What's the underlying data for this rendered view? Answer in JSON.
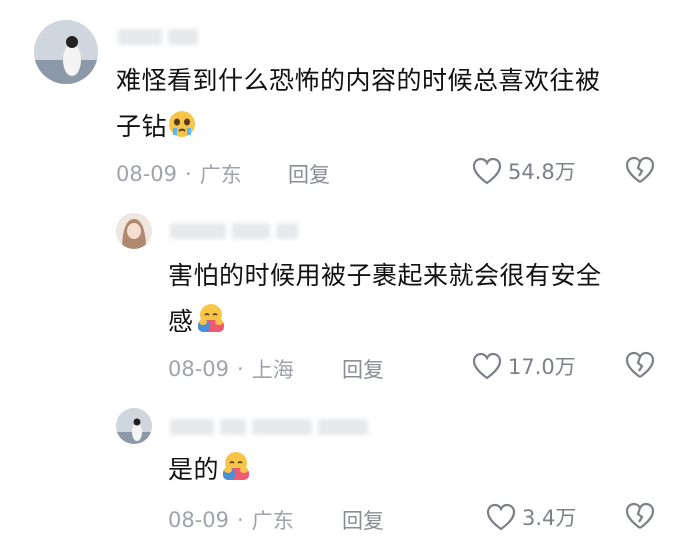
{
  "comments": [
    {
      "text_line1": "难怪看到什么恐怖的内容的时候总喜欢往被",
      "text_line2": "子钻",
      "emoji": "crying-face",
      "date": "08-09",
      "location": "广东",
      "reply": "回复",
      "likes": "54.8万"
    },
    {
      "text_line1": "害怕的时候用被子裹起来就会很有安全",
      "text_line2": "感",
      "emoji": "hugging-face",
      "date": "08-09",
      "location": "上海",
      "reply": "回复",
      "likes": "17.0万"
    },
    {
      "text_line1": "是的",
      "emoji": "hugging-face",
      "date": "08-09",
      "location": "广东",
      "reply": "回复",
      "likes": "3.4万"
    }
  ],
  "meta_separator": "·",
  "colors": {
    "text": "#111111",
    "meta": "#a0a3a9",
    "icon": "#7d8087"
  }
}
